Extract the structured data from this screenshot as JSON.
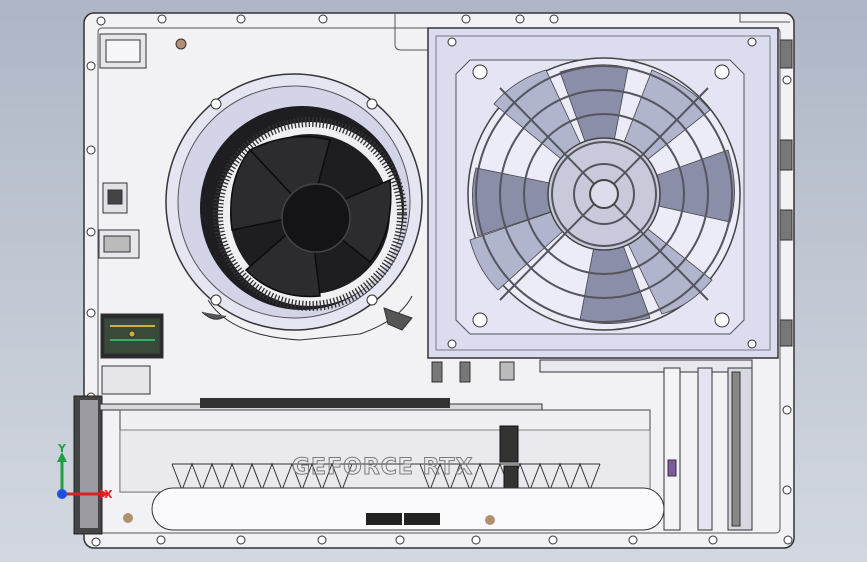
{
  "model": {
    "gpu_label": "GEFORCE RTX"
  },
  "triad": {
    "x_label": "X",
    "y_label": "Y",
    "x_color": "#e02020",
    "y_color": "#20a040",
    "z_color": "#2050e0"
  },
  "colors": {
    "panel": "#f2f2f4",
    "edge": "#333338",
    "psu_body": "#dcdcef",
    "fan_dark": "#222226",
    "background_top": "#aeb6c6",
    "background_bottom": "#d3d8e0"
  },
  "icons": {
    "cooler": "cpu-cooler-icon",
    "psu_fan": "psu-fan-icon",
    "triad": "coordinate-triad-icon"
  }
}
